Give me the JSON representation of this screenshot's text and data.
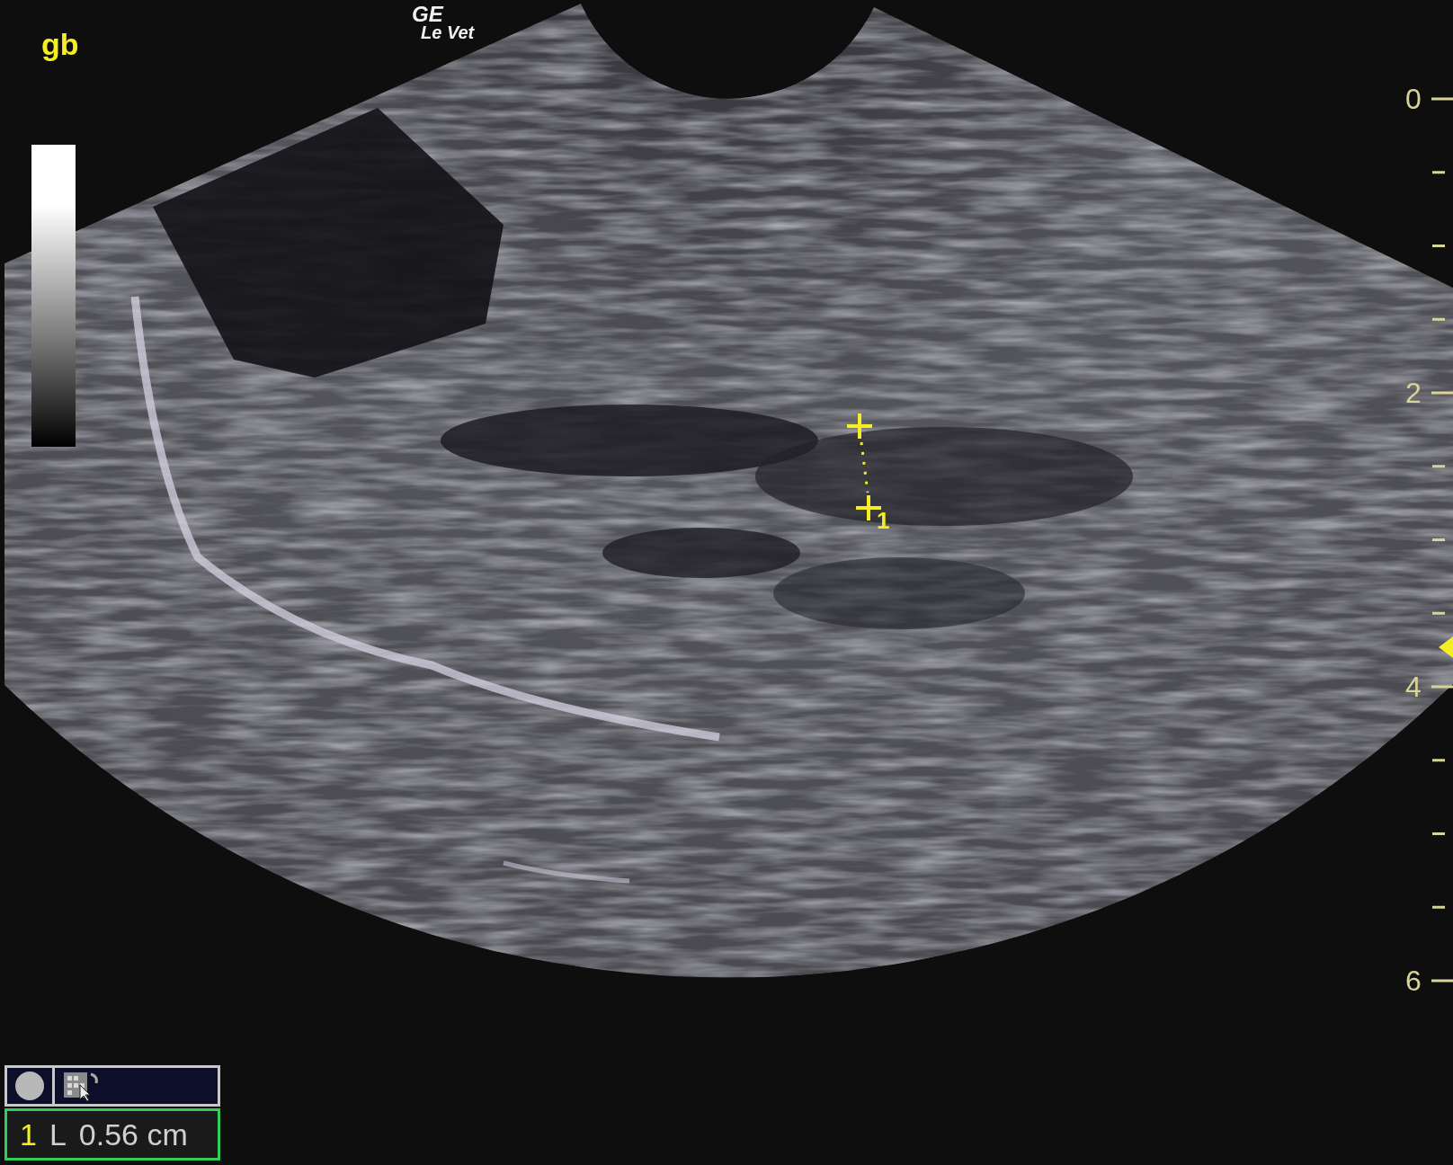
{
  "annotation": "gb",
  "logo": {
    "line_1": "GE",
    "line_2": "Le Vet"
  },
  "depth_scale": {
    "labels": [
      "0",
      "2",
      "4",
      "6"
    ]
  },
  "caliper": {
    "label": "1"
  },
  "measurements": [
    {
      "index": "1",
      "type": "L",
      "value": "0.56 cm",
      "selected": true
    }
  ]
}
